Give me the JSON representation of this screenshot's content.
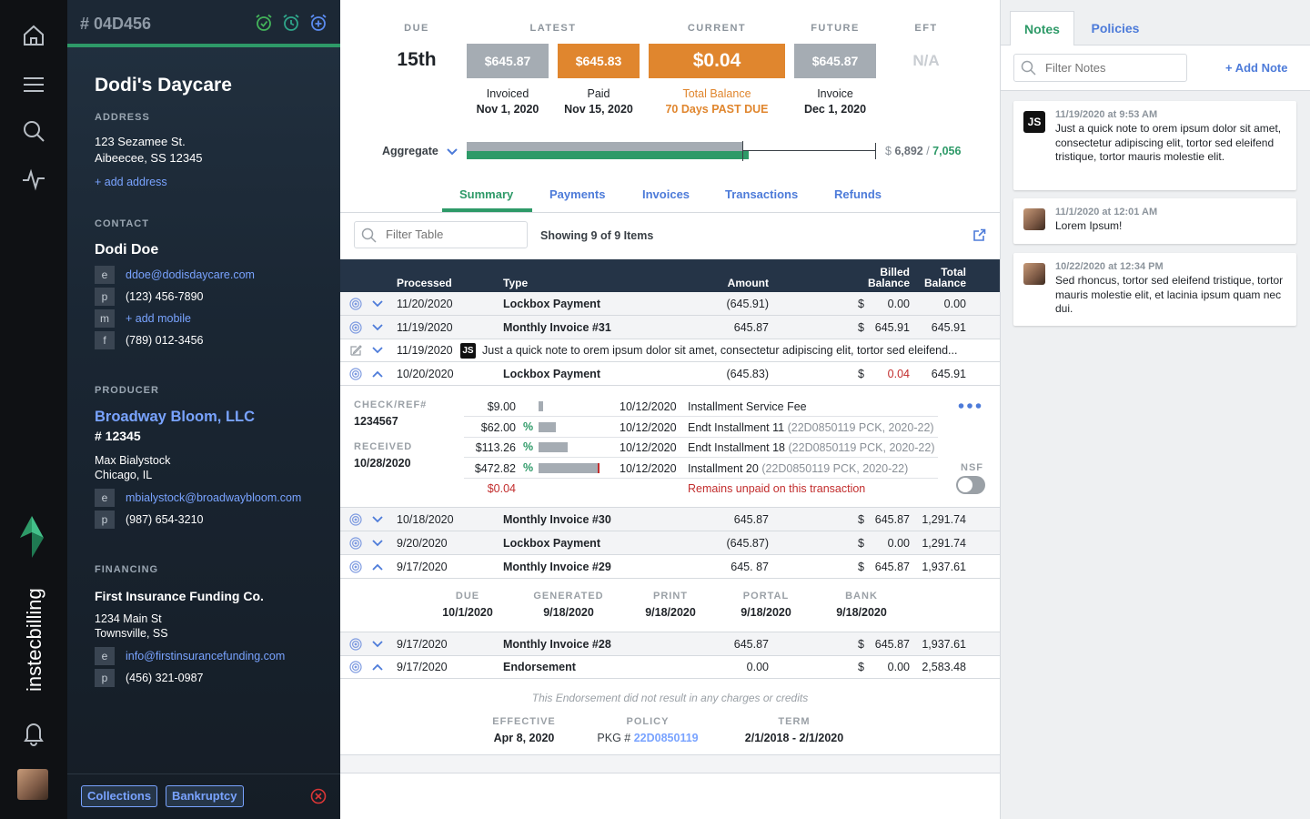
{
  "colors": {
    "accent_green": "#2e9a68",
    "link_blue": "#4d7bd9",
    "orange": "#e0862e",
    "grey_box": "#a5acb3",
    "red": "#c22d2d"
  },
  "account": {
    "number": "# 04D456",
    "name": "Dodi's Daycare",
    "address_label": "ADDRESS",
    "address_line1": "123 Sezamee St.",
    "address_line2": "Aibeecee, SS 12345",
    "add_address": "+ add address",
    "contact_label": "CONTACT",
    "contact_name": "Dodi Doe",
    "contact": [
      {
        "tag": "e",
        "value": "ddoe@dodisdaycare.com",
        "link": true
      },
      {
        "tag": "p",
        "value": "(123) 456-7890",
        "link": false
      },
      {
        "tag": "m",
        "value": "+ add mobile",
        "link": true
      },
      {
        "tag": "f",
        "value": "(789) 012-3456",
        "link": false
      }
    ],
    "producer_label": "PRODUCER",
    "producer_name": "Broadway Bloom, LLC",
    "producer_num": "# 12345",
    "producer_person": "Max Bialystock",
    "producer_city": "Chicago, IL",
    "producer_contact": [
      {
        "tag": "e",
        "value": "mbialystock@broadwaybloom.com",
        "link": true
      },
      {
        "tag": "p",
        "value": "(987) 654-3210",
        "link": false
      }
    ],
    "financing_label": "FINANCING",
    "financing_name": "First Insurance Funding Co.",
    "financing_addr1": "1234 Main St",
    "financing_addr2": "Townsville, SS",
    "financing_contact": [
      {
        "tag": "e",
        "value": "info@firstinsurancefunding.com",
        "link": true
      },
      {
        "tag": "p",
        "value": "(456) 321-0987",
        "link": false
      }
    ],
    "footer_buttons": [
      "Collections",
      "Bankruptcy"
    ]
  },
  "brand": {
    "name": "instecbilling"
  },
  "summary": {
    "due": {
      "header": "DUE",
      "value": "15th"
    },
    "latest": {
      "header": "LATEST",
      "invoiced_amount": "$645.87",
      "invoiced_label": "Invoiced",
      "invoiced_date": "Nov 1, 2020",
      "paid_amount": "$645.83",
      "paid_label": "Paid",
      "paid_date": "Nov 15, 2020"
    },
    "current": {
      "header": "CURRENT",
      "amount": "$0.04",
      "label": "Total Balance",
      "status": "70 Days PAST DUE"
    },
    "future": {
      "header": "FUTURE",
      "amount": "$645.87",
      "label": "Invoice",
      "date": "Dec 1, 2020"
    },
    "eft": {
      "header": "EFT",
      "value": "N/A"
    },
    "aggregate": {
      "label": "Aggregate",
      "dollar": "$",
      "paid": "6,892",
      "sep": "/",
      "total": "7,056",
      "paid_value": 6892,
      "total_value": 7056
    }
  },
  "tabs": [
    "Summary",
    "Payments",
    "Invoices",
    "Transactions",
    "Refunds"
  ],
  "table": {
    "filter_placeholder": "Filter Table",
    "showing": "Showing 9 of 9 Items",
    "headers": {
      "processed": "Processed",
      "type": "Type",
      "amount": "Amount",
      "billed": "Billed",
      "billed2": "Balance",
      "total": "Total",
      "total2": "Balance"
    },
    "rows": [
      {
        "date": "11/20/2020",
        "type": "Lockbox Payment",
        "amount": "(645.91)",
        "cur": "$",
        "billed": "0.00",
        "total": "0.00"
      },
      {
        "date": "11/19/2020",
        "type": "Monthly Invoice #31",
        "amount": "645.87",
        "cur": "$",
        "billed": "645.91",
        "total": "645.91"
      },
      {
        "date": "11/19/2020",
        "initials": "JS",
        "note": "Just a quick note to orem ipsum dolor sit amet, consectetur adipiscing elit, tortor sed eleifend..."
      },
      {
        "date": "10/20/2020",
        "type": "Lockbox Payment",
        "amount": "(645.83)",
        "cur": "$",
        "billed": "0.04",
        "total": "645.91"
      },
      {
        "date": "10/18/2020",
        "type": "Monthly Invoice #30",
        "amount": "645.87",
        "cur": "$",
        "billed": "645.87",
        "total": "1,291.74"
      },
      {
        "date": "9/20/2020",
        "type": "Lockbox Payment",
        "amount": "(645.87)",
        "cur": "$",
        "billed": "0.00",
        "total": "1,291.74"
      },
      {
        "date": "9/17/2020",
        "type": "Monthly Invoice #29",
        "amount": "645. 87",
        "cur": "$",
        "billed": "645.87",
        "total": "1,937.61"
      },
      {
        "date": "9/17/2020",
        "type": "Monthly Invoice #28",
        "amount": "645.87",
        "cur": "$",
        "billed": "645.87",
        "total": "1,937.61"
      },
      {
        "date": "9/17/2020",
        "type": "Endorsement",
        "amount": "0.00",
        "cur": "$",
        "billed": "0.00",
        "total": "2,583.48"
      }
    ],
    "payment_detail": {
      "check_label": "CHECK/REF#",
      "check_value": "1234567",
      "received_label": "RECEIVED",
      "received_value": "10/28/2020",
      "allocations": [
        {
          "amount": "$9.00",
          "pct": "",
          "fill": 0.08,
          "date": "10/12/2020",
          "desc": "Installment Service Fee",
          "ref": ""
        },
        {
          "amount": "$62.00",
          "pct": "%",
          "fill": 0.28,
          "date": "10/12/2020",
          "desc": "Endt Installment 11",
          "ref": "(22D0850119 PCK, 2020-22)"
        },
        {
          "amount": "$113.26",
          "pct": "%",
          "fill": 0.47,
          "date": "10/12/2020",
          "desc": "Endt Installment 18",
          "ref": "(22D0850119 PCK, 2020-22)"
        },
        {
          "amount": "$472.82",
          "pct": "%",
          "fill": 0.99,
          "date": "10/12/2020",
          "desc": "Installment 20",
          "ref": "(22D0850119 PCK, 2020-22)"
        }
      ],
      "unpaid_amount": "$0.04",
      "unpaid_text": "Remains unpaid on this transaction",
      "nsf_label": "NSF"
    },
    "invoice_detail": {
      "due_label": "DUE",
      "due": "10/1/2020",
      "generated_label": "GENERATED",
      "generated": "9/18/2020",
      "print_label": "PRINT",
      "print": "9/18/2020",
      "portal_label": "PORTAL",
      "portal": "9/18/2020",
      "bank_label": "BANK",
      "bank": "9/18/2020"
    },
    "endorsement_detail": {
      "note": "This Endorsement did not result in any charges or credits",
      "effective_label": "EFFECTIVE",
      "effective": "Apr 8, 2020",
      "policy_label": "POLICY",
      "policy_prefix": "PKG #",
      "policy": "22D0850119",
      "term_label": "TERM",
      "term": "2/1/2018 - 2/1/2020"
    }
  },
  "notes_panel": {
    "tabs": [
      "Notes",
      "Policies"
    ],
    "filter_placeholder": "Filter Notes",
    "add_note": "+ Add Note",
    "notes": [
      {
        "initials": "JS",
        "date": "11/19/2020 at 9:53 AM",
        "text": "Just a quick note to orem ipsum dolor sit amet, consectetur adipiscing elit, tortor sed eleifend tristique, tortor mauris molestie elit."
      },
      {
        "initials": "",
        "date": "11/1/2020 at 12:01 AM",
        "text": "Lorem Ipsum!"
      },
      {
        "initials": "",
        "date": "10/22/2020 at 12:34 PM",
        "text": "Sed rhoncus, tortor sed eleifend tristique, tortor mauris molestie elit, et lacinia ipsum quam nec dui."
      }
    ]
  }
}
